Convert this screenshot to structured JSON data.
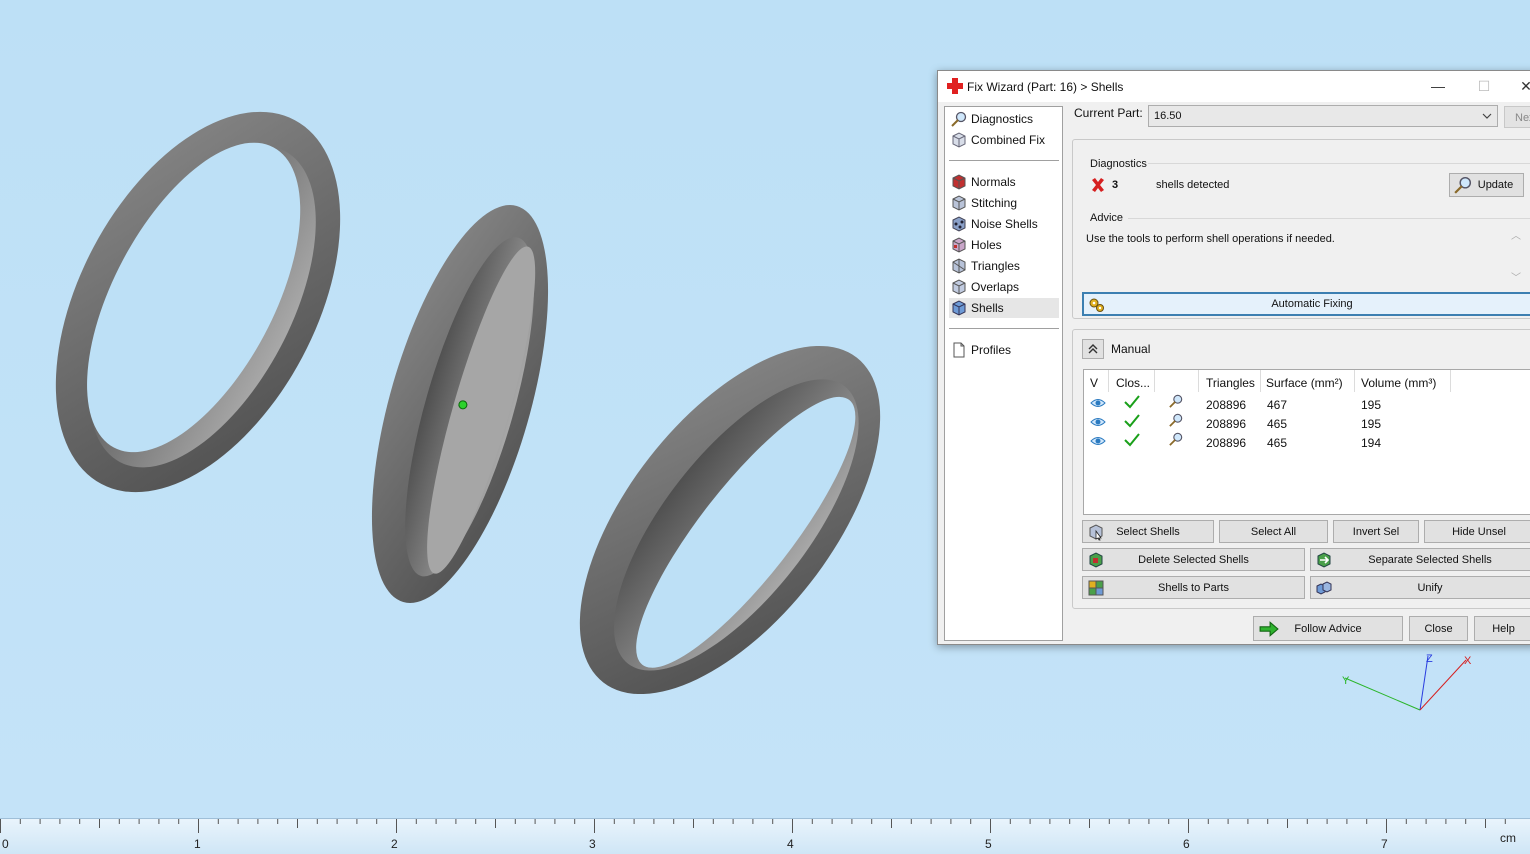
{
  "window": {
    "title": "Fix Wizard (Part: 16) > Shells",
    "icon": "red-cross-icon",
    "controls": {
      "minimize": "—",
      "maximize": "☐",
      "close": "✕"
    }
  },
  "sidebar": {
    "groups": [
      {
        "items": [
          {
            "label": "Diagnostics",
            "icon": "magnifier-icon"
          },
          {
            "label": "Combined Fix",
            "icon": "cube-icon"
          }
        ]
      },
      {
        "items": [
          {
            "label": "Normals",
            "icon": "normals-cube-icon"
          },
          {
            "label": "Stitching",
            "icon": "stitching-cube-icon"
          },
          {
            "label": "Noise Shells",
            "icon": "noise-shells-icon"
          },
          {
            "label": "Holes",
            "icon": "holes-cube-icon"
          },
          {
            "label": "Triangles",
            "icon": "triangles-cube-icon"
          },
          {
            "label": "Overlaps",
            "icon": "overlaps-cube-icon"
          },
          {
            "label": "Shells",
            "icon": "shells-cube-icon",
            "selected": true
          }
        ]
      },
      {
        "items": [
          {
            "label": "Profiles",
            "icon": "document-icon"
          }
        ]
      }
    ]
  },
  "current_part": {
    "label": "Current Part:",
    "value": "16.50",
    "next_label": "Next"
  },
  "diagnostics": {
    "label": "Diagnostics",
    "count": "3",
    "text": "shells detected",
    "status_icon": "red-x-icon",
    "update_label": "Update"
  },
  "advice": {
    "label": "Advice",
    "text": "Use the tools to perform shell operations if needed."
  },
  "automatic_fixing_label": "Automatic Fixing",
  "manual": {
    "label": "Manual",
    "columns": [
      "V",
      "Clos...",
      "",
      "Triangles",
      "Surface (mm²)",
      "Volume (mm³)"
    ],
    "rows": [
      {
        "triangles": "208896",
        "surface": "467",
        "volume": "195"
      },
      {
        "triangles": "208896",
        "surface": "465",
        "volume": "195"
      },
      {
        "triangles": "208896",
        "surface": "465",
        "volume": "194"
      }
    ],
    "buttons": {
      "select_shells": "Select Shells",
      "select_all": "Select All",
      "invert_sel": "Invert Sel",
      "hide_unsel": "Hide Unsel",
      "delete_selected": "Delete Selected Shells",
      "separate_selected": "Separate Selected Shells",
      "shells_to_parts": "Shells to Parts",
      "unify": "Unify"
    }
  },
  "footer": {
    "follow_advice": "Follow Advice",
    "close": "Close",
    "help": "Help"
  },
  "ruler": {
    "labels": [
      "0",
      "1",
      "2",
      "3",
      "4",
      "5",
      "6",
      "7"
    ],
    "unit": "cm"
  },
  "axes": {
    "x": "X",
    "y": "Y",
    "z": "Z"
  },
  "colors": {
    "viewport_bg": "#bfe0f7",
    "ring": "#6e6e6e",
    "accent": "#3c7fb1",
    "check": "#1aa01a",
    "error": "#d62020"
  }
}
